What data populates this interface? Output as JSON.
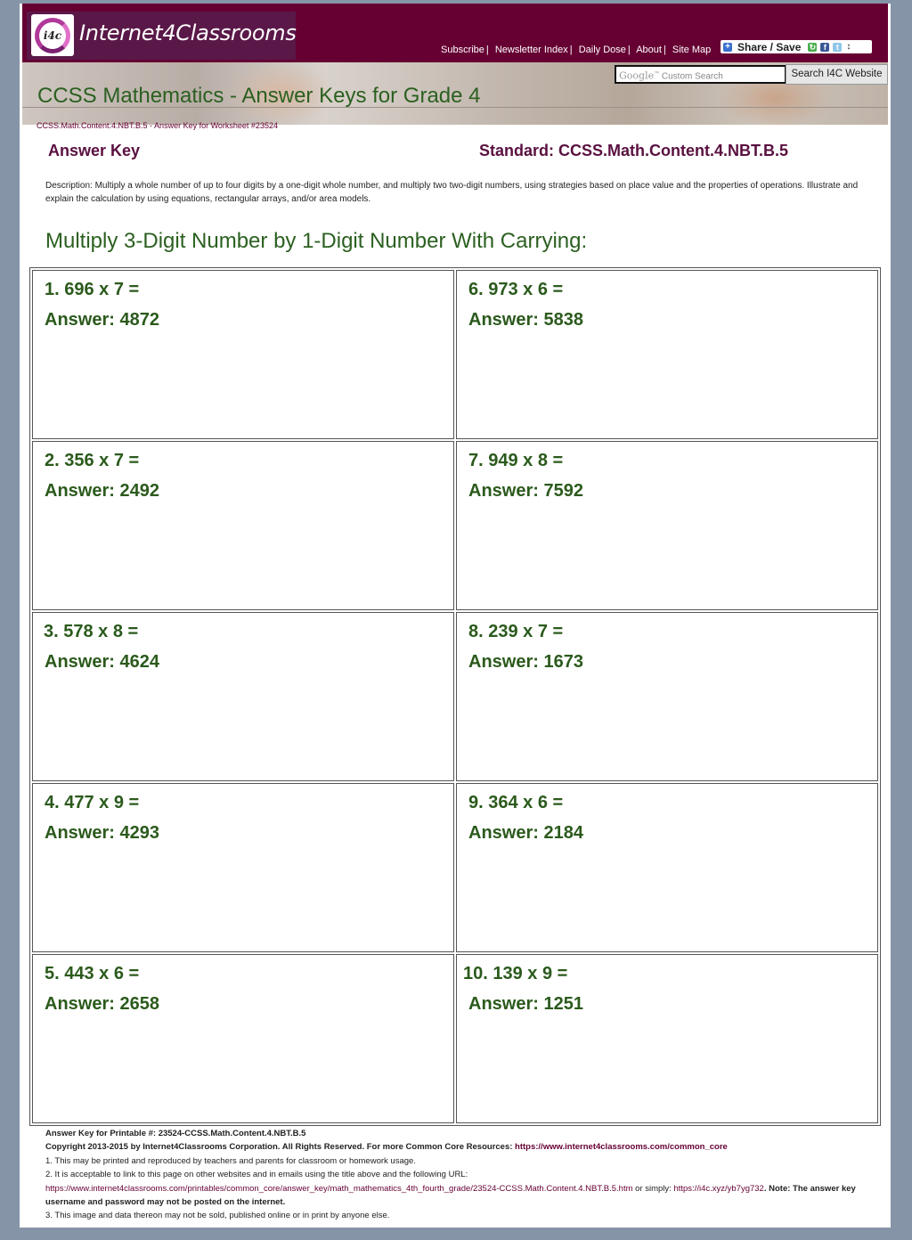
{
  "header": {
    "logo_icon_text": "i4c",
    "logo_text": "Internet4Classrooms",
    "nav": [
      {
        "label": "Subscribe"
      },
      {
        "label": "Newsletter Index"
      },
      {
        "label": "Daily Dose"
      },
      {
        "label": "About"
      },
      {
        "label": "Site Map"
      }
    ],
    "nav_separator": "|",
    "share_label": "Share / Save",
    "share_arrows": "↕"
  },
  "search": {
    "google_label": "Google",
    "placeholder": "Custom Search",
    "button_label": "Search I4C Website"
  },
  "page_title": "CCSS Mathematics - Answer Keys for Grade 4",
  "breadcrumb": "CCSS.Math.Content.4.NBT.B.5 - Answer Key for Worksheet #23524",
  "answer_key_label": "Answer Key",
  "standard_label": "Standard: CCSS.Math.Content.4.NBT.B.5",
  "description": "Description: Multiply a whole number of up to four digits by a one-digit whole number, and multiply two two-digit numbers, using strategies based on place value and the properties of operations. Illustrate and explain the calculation by using equations, rectangular arrays, and/or area models.",
  "section_title": "Multiply 3-Digit Number by 1-Digit Number With Carrying:",
  "problems": [
    {
      "question": "1. 696 x 7 =",
      "answer": "Answer: 4872"
    },
    {
      "question": "2. 356 x 7 =",
      "answer": "Answer: 2492"
    },
    {
      "question": "3. 578 x 8 =",
      "answer": "Answer: 4624"
    },
    {
      "question": "4. 477 x 9 =",
      "answer": "Answer: 4293"
    },
    {
      "question": "5. 443 x 6 =",
      "answer": "Answer: 2658"
    },
    {
      "question": "6. 973 x 6 =",
      "answer": "Answer: 5838"
    },
    {
      "question": "7. 949 x 8 =",
      "answer": "Answer: 7592"
    },
    {
      "question": "8. 239 x 7 =",
      "answer": "Answer: 1673"
    },
    {
      "question": "9. 364 x 6 =",
      "answer": "Answer: 2184"
    },
    {
      "question": "10. 139 x 9 =",
      "answer": "Answer: 1251"
    }
  ],
  "footer": {
    "printable": "Answer Key for Printable #: 23524-CCSS.Math.Content.4.NBT.B.5",
    "copyright": "Copyright 2013-2015 by Internet4Classrooms Corporation. All Rights Reserved. For more Common Core Resources: ",
    "common_core_link": "https://www.internet4classrooms.com/common_core",
    "note1": "1. This may be printed and reproduced by teachers and parents for classroom or homework usage.",
    "note2": "2. It is acceptable to link to this page on other websites and in emails using the title above and the following URL:",
    "full_url": "https://www.internet4classrooms.com/printables/common_core/answer_key/math_mathematics_4th_fourth_grade/23524-CCSS.Math.Content.4.NBT.B.5.htm",
    "or_simply": " or simply: ",
    "short_url": "https://i4c.xyz/yb7yg732",
    "note_bold": ". Note: The answer key username and password may not be posted on the internet.",
    "note3": "3. This image and data thereon may not be sold, published online or in print by anyone else."
  }
}
